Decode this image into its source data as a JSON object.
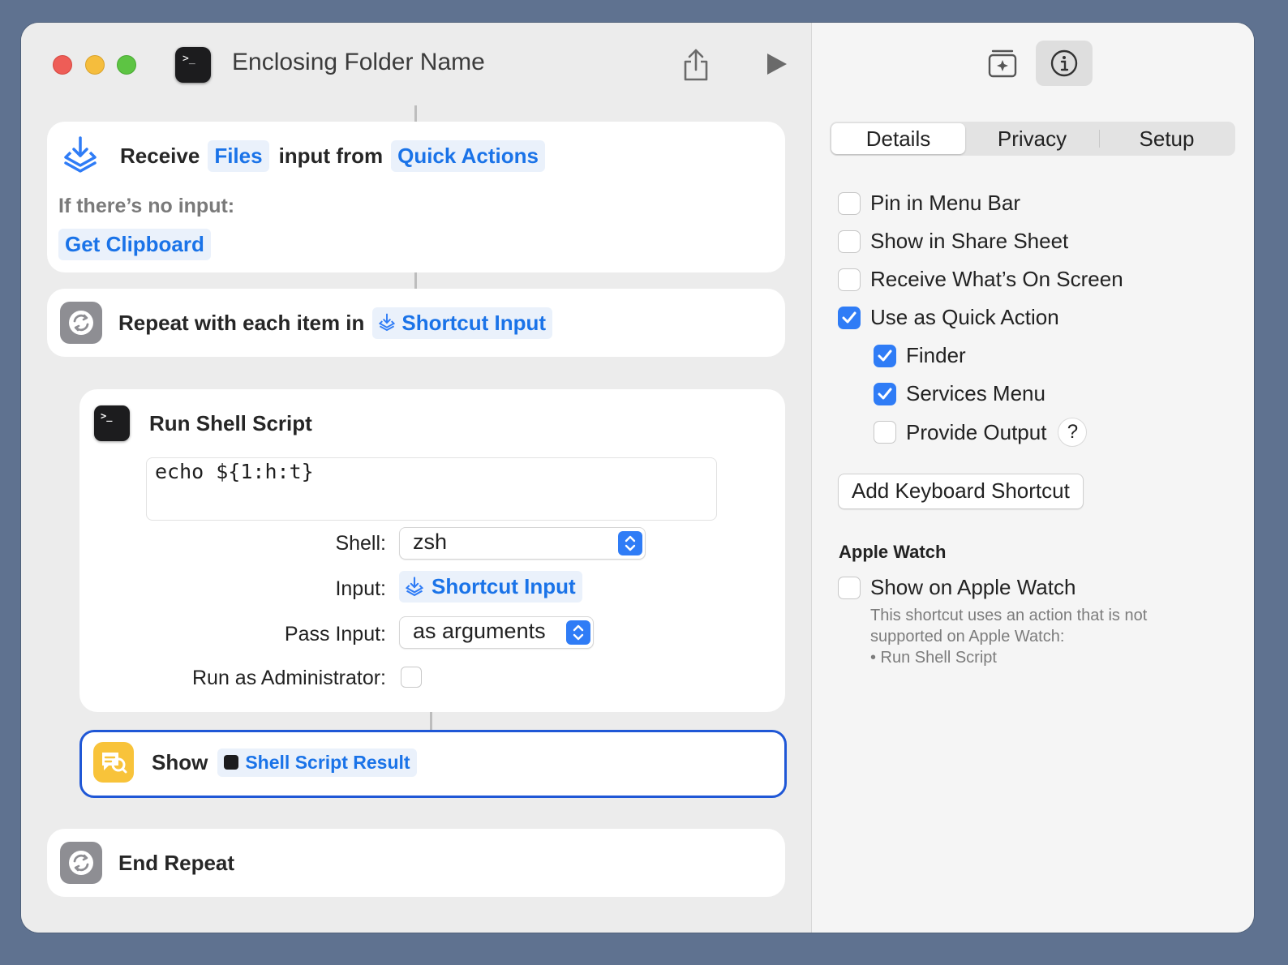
{
  "window": {
    "title": "Enclosing Folder Name"
  },
  "toolbar": {
    "share_icon": "share-icon",
    "run_icon": "play-icon",
    "add_to_dock_icon": "add-to-dock-icon",
    "info_icon": "info-icon"
  },
  "workflow": {
    "receive": {
      "receive_label": "Receive",
      "files_token": "Files",
      "input_from_label": "input from",
      "source_token": "Quick Actions",
      "no_input_label": "If there’s no input:",
      "no_input_action": "Get Clipboard"
    },
    "repeat": {
      "label": "Repeat with each item in",
      "token": "Shortcut Input"
    },
    "shell": {
      "title": "Run Shell Script",
      "script": "echo ${1:h:t}",
      "shell_label": "Shell:",
      "shell_value": "zsh",
      "input_label": "Input:",
      "input_value": "Shortcut Input",
      "pass_input_label": "Pass Input:",
      "pass_input_value": "as arguments",
      "admin_label": "Run as Administrator:",
      "admin_checked": false
    },
    "show": {
      "label": "Show",
      "token": "Shell Script Result"
    },
    "end_repeat": {
      "label": "End Repeat"
    }
  },
  "details": {
    "tabs": [
      "Details",
      "Privacy",
      "Setup"
    ],
    "active_tab": "Details",
    "options": {
      "pin_menu_bar": {
        "label": "Pin in Menu Bar",
        "checked": false
      },
      "share_sheet": {
        "label": "Show in Share Sheet",
        "checked": false
      },
      "receive_screen": {
        "label": "Receive What’s On Screen",
        "checked": false
      },
      "quick_action": {
        "label": "Use as Quick Action",
        "checked": true
      },
      "finder": {
        "label": "Finder",
        "checked": true
      },
      "services_menu": {
        "label": "Services Menu",
        "checked": true
      },
      "provide_output": {
        "label": "Provide Output",
        "checked": false
      }
    },
    "help_label": "?",
    "add_shortcut_label": "Add Keyboard Shortcut",
    "apple_watch": {
      "heading": "Apple Watch",
      "show_label": "Show on Apple Watch",
      "checked": false,
      "note_line1": "This shortcut uses an action that is not",
      "note_line2": "supported on Apple Watch:",
      "note_line3": "• Run Shell Script"
    }
  },
  "colors": {
    "accent": "#2f7cf6",
    "token_text": "#1a73e8",
    "selected_border": "#1f57d6",
    "show_icon": "#f8c33a"
  }
}
